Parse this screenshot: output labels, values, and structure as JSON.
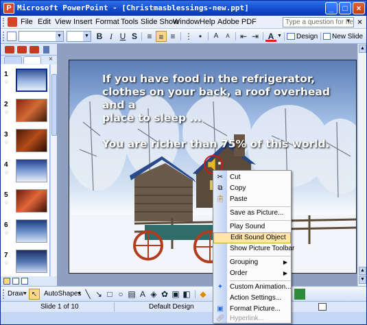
{
  "window": {
    "title": "Microsoft PowerPoint - [Christmasblessings-new.ppt]",
    "app_icon": "P",
    "controls": [
      "_",
      "□",
      "×"
    ]
  },
  "menu": {
    "items": [
      "File",
      "Edit",
      "View",
      "Insert",
      "Format",
      "Tools",
      "Slide Show",
      "Window",
      "Help",
      "Adobe PDF"
    ],
    "help_placeholder": "Type a question for help",
    "close_doc": "×"
  },
  "toolbar": {
    "bold": "B",
    "italic": "I",
    "underline": "U",
    "shadow": "S",
    "font_color": "A",
    "design_label": "Design",
    "new_slide_label": "New Slide"
  },
  "slides_panel": {
    "numbers": [
      "1",
      "2",
      "3",
      "4",
      "5",
      "6",
      "7"
    ],
    "selected": "1"
  },
  "slide": {
    "text": "If you have food in the refrigerator,\nclothes on your back, a roof overhead and a\nplace to sleep ...\n\nYou are richer than 75% of this world."
  },
  "draw_toolbar": {
    "draw_label": "Draw",
    "autoshapes_label": "AutoShapes"
  },
  "status": {
    "slide": "Slide 1 of 10",
    "design": "Default Design"
  },
  "context_menu": {
    "cut": "Cut",
    "copy": "Copy",
    "paste": "Paste",
    "save_as_picture": "Save as Picture...",
    "play_sound": "Play Sound",
    "edit_sound_object": "Edit Sound Object",
    "show_picture_toolbar": "Show Picture Toolbar",
    "grouping": "Grouping",
    "order": "Order",
    "custom_animation": "Custom Animation...",
    "action_settings": "Action Settings...",
    "format_picture": "Format Picture...",
    "hyperlink": "Hyperlink..."
  },
  "colors": {
    "title_bar": "#1148c9",
    "menu_highlight": "#ffe8a6",
    "slide_background": "#5b7db6"
  }
}
